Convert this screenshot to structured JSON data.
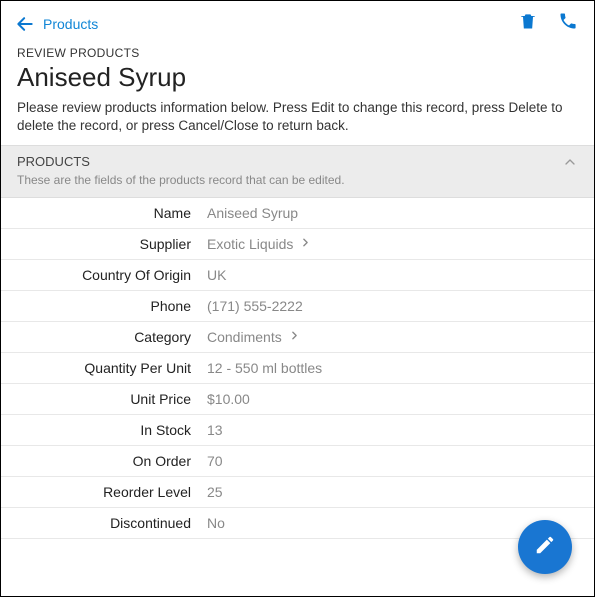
{
  "topbar": {
    "back_label": "Products"
  },
  "header": {
    "review_label": "REVIEW PRODUCTS",
    "title": "Aniseed Syrup",
    "description": "Please review products information below. Press Edit to change this record, press Delete to delete the record, or press Cancel/Close to return back."
  },
  "section": {
    "title": "PRODUCTS",
    "subtitle": "These are the fields of the products record that can be edited."
  },
  "fields": {
    "name": {
      "label": "Name",
      "value": "Aniseed Syrup"
    },
    "supplier": {
      "label": "Supplier",
      "value": "Exotic Liquids"
    },
    "country": {
      "label": "Country Of Origin",
      "value": "UK"
    },
    "phone": {
      "label": "Phone",
      "value": "(171) 555-2222"
    },
    "category": {
      "label": "Category",
      "value": "Condiments"
    },
    "qty_per_unit": {
      "label": "Quantity Per Unit",
      "value": "12 - 550 ml bottles"
    },
    "unit_price": {
      "label": "Unit Price",
      "value": "$10.00"
    },
    "in_stock": {
      "label": "In Stock",
      "value": "13"
    },
    "on_order": {
      "label": "On Order",
      "value": "70"
    },
    "reorder_level": {
      "label": "Reorder Level",
      "value": "25"
    },
    "discontinued": {
      "label": "Discontinued",
      "value": "No"
    }
  }
}
